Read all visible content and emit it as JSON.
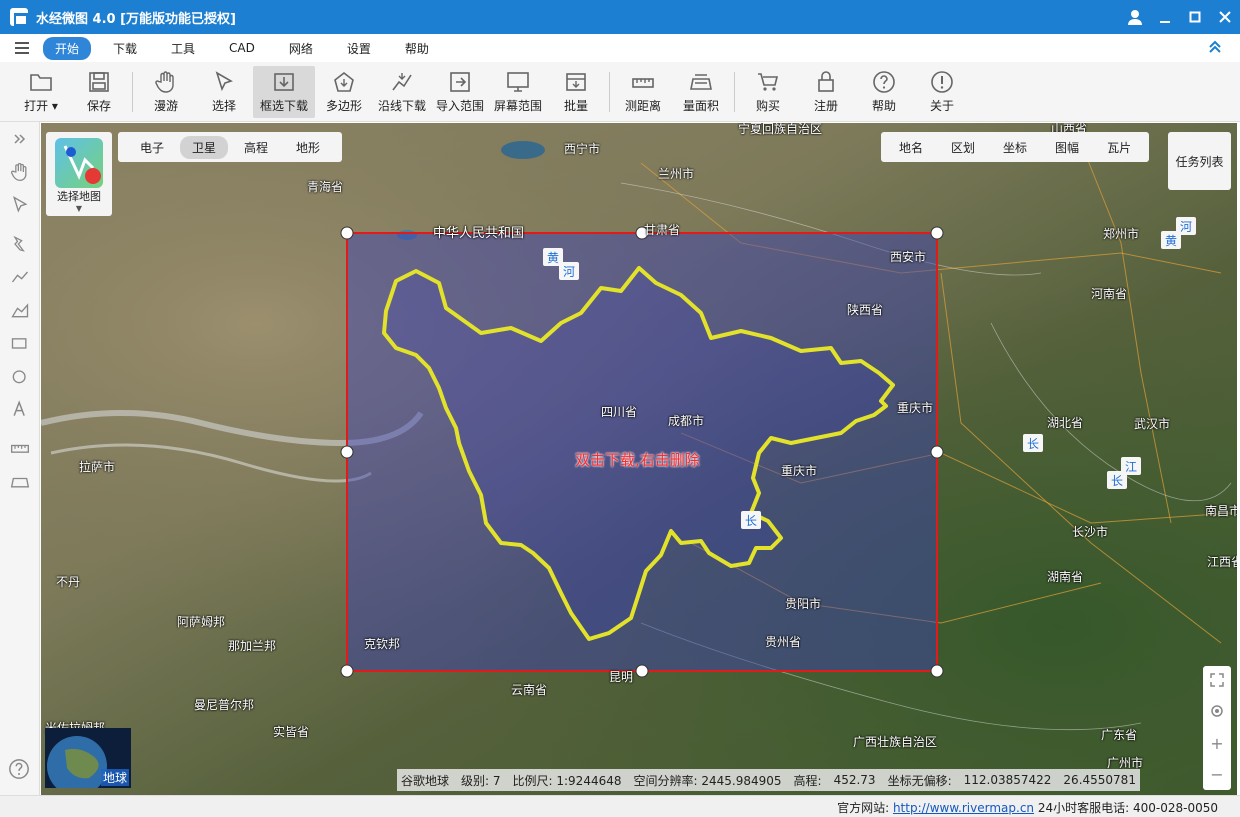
{
  "window": {
    "title": "水经微图 4.0 [万能版功能已授权]"
  },
  "menu": [
    "开始",
    "下载",
    "工具",
    "CAD",
    "网络",
    "设置",
    "帮助"
  ],
  "toolbar": [
    {
      "label": "打开",
      "icon": "folder-icon",
      "dropdown": true
    },
    {
      "label": "保存",
      "icon": "save-icon"
    },
    {
      "label": "漫游",
      "icon": "hand-icon"
    },
    {
      "label": "选择",
      "icon": "cursor-icon"
    },
    {
      "label": "框选下载",
      "icon": "box-download-icon",
      "active": true
    },
    {
      "label": "多边形",
      "icon": "polygon-icon"
    },
    {
      "label": "沿线下载",
      "icon": "line-download-icon"
    },
    {
      "label": "导入范围",
      "icon": "import-icon"
    },
    {
      "label": "屏幕范围",
      "icon": "screen-icon"
    },
    {
      "label": "批量",
      "icon": "batch-icon"
    },
    {
      "label": "测距离",
      "icon": "ruler-icon"
    },
    {
      "label": "量面积",
      "icon": "area-icon"
    },
    {
      "label": "购买",
      "icon": "cart-icon"
    },
    {
      "label": "注册",
      "icon": "lock-icon"
    },
    {
      "label": "帮助",
      "icon": "question-icon"
    },
    {
      "label": "关于",
      "icon": "info-icon"
    }
  ],
  "map": {
    "types": [
      "电子",
      "卫星",
      "高程",
      "地形"
    ],
    "selected_type": "卫星",
    "select_map_label": "选择地图",
    "layers": [
      "地名",
      "区划",
      "坐标",
      "图幅",
      "瓦片"
    ],
    "task_list_label": "任务列表",
    "globe_label": "地球",
    "selection_hint": "双击下载,右击删除",
    "labels": [
      {
        "text": "宁夏回族自治区",
        "kind": "region"
      },
      {
        "text": "西宁市",
        "kind": "city"
      },
      {
        "text": "兰州市",
        "kind": "city"
      },
      {
        "text": "青海省",
        "kind": "region"
      },
      {
        "text": "中华人民共和国",
        "kind": "country"
      },
      {
        "text": "甘肃省",
        "kind": "region"
      },
      {
        "text": "西安市",
        "kind": "city"
      },
      {
        "text": "陕西省",
        "kind": "region"
      },
      {
        "text": "郑州市",
        "kind": "city"
      },
      {
        "text": "河南省",
        "kind": "region"
      },
      {
        "text": "四川省",
        "kind": "region"
      },
      {
        "text": "成都市",
        "kind": "city"
      },
      {
        "text": "重庆市",
        "kind": "region"
      },
      {
        "text": "湖北省",
        "kind": "region"
      },
      {
        "text": "武汉市",
        "kind": "city"
      },
      {
        "text": "拉萨市",
        "kind": "city"
      },
      {
        "text": "重庆市",
        "kind": "city"
      },
      {
        "text": "长沙市",
        "kind": "city"
      },
      {
        "text": "南昌市",
        "kind": "city"
      },
      {
        "text": "不丹",
        "kind": "country"
      },
      {
        "text": "湖南省",
        "kind": "region"
      },
      {
        "text": "江西省",
        "kind": "region"
      },
      {
        "text": "阿萨姆邦",
        "kind": "region"
      },
      {
        "text": "那加兰邦",
        "kind": "region"
      },
      {
        "text": "贵阳市",
        "kind": "city"
      },
      {
        "text": "贵州省",
        "kind": "region"
      },
      {
        "text": "克钦邦",
        "kind": "region"
      },
      {
        "text": "昆明",
        "kind": "city"
      },
      {
        "text": "云南省",
        "kind": "region"
      },
      {
        "text": "曼尼普尔邦",
        "kind": "region"
      },
      {
        "text": "米佐拉姆邦",
        "kind": "region"
      },
      {
        "text": "实皆省",
        "kind": "region"
      },
      {
        "text": "广西壮族自治区",
        "kind": "region"
      },
      {
        "text": "广东省",
        "kind": "region"
      },
      {
        "text": "广州市",
        "kind": "city"
      },
      {
        "text": "山西省",
        "kind": "region"
      }
    ],
    "rivers": [
      "黄",
      "河",
      "黄",
      "河",
      "长",
      "江",
      "长",
      "长"
    ]
  },
  "map_info": {
    "source": "谷歌地球",
    "level": "级别: 7",
    "scale": "比例尺: 1:9244648",
    "resolution": "空间分辨率: 2445.984905",
    "elevation": "高程:",
    "elevation_value": "452.73",
    "coord_label": "坐标无偏移:",
    "coord_value": "112.03857422",
    "coord_value2": "26.4550781"
  },
  "status": {
    "website_label": "官方网站:",
    "website_url": "http://www.rivermap.cn",
    "hotline": "24小时客服电话: 400-028-0050"
  },
  "colors": {
    "titlebar": "#1c7fd1",
    "selection_border": "#e21a1a",
    "boundary": "#e3e22a",
    "selection_fill": "#3a3fb8"
  }
}
